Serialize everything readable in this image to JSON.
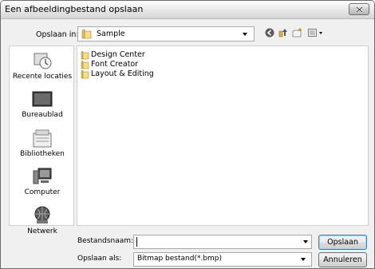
{
  "window": {
    "title": "Een afbeeldingbestand opslaan"
  },
  "toolbar": {
    "save_in_label": "Opslaan in:",
    "save_in_value": "Sample",
    "icons": [
      "back-icon",
      "up-folder-icon",
      "new-folder-icon",
      "view-menu-icon"
    ]
  },
  "places": [
    {
      "label": "Recente locaties",
      "icon": "recent-locations-icon"
    },
    {
      "label": "Bureaublad",
      "icon": "desktop-icon"
    },
    {
      "label": "Bibliotheken",
      "icon": "libraries-icon"
    },
    {
      "label": "Computer",
      "icon": "computer-icon"
    },
    {
      "label": "Netwerk",
      "icon": "network-icon"
    }
  ],
  "files": [
    {
      "name": "Design Center"
    },
    {
      "name": "Font Creator"
    },
    {
      "name": "Layout & Editing"
    }
  ],
  "form": {
    "filename_label": "Bestandsnaam:",
    "filename_value": "",
    "filetype_label": "Opslaan als:",
    "filetype_value": "Bitmap bestand(*.bmp)",
    "save_button": "Opslaan",
    "cancel_button": "Annuleren"
  }
}
